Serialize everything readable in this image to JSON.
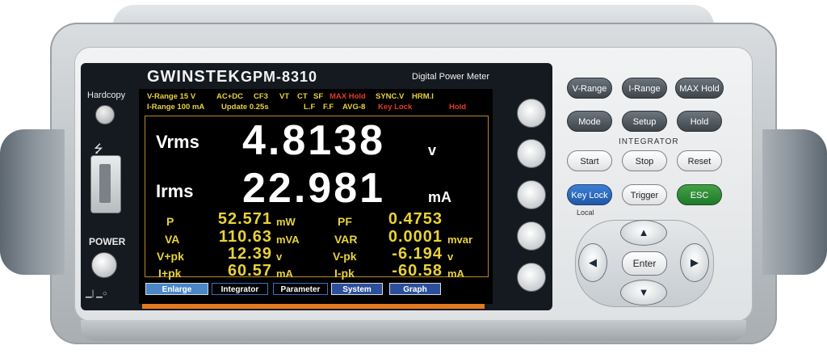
{
  "device": {
    "brand": "GWINSTEK",
    "model": "GPM-8310",
    "subtitle": "Digital Power Meter"
  },
  "left_panel": {
    "hardcopy_label": "Hardcopy",
    "usb_icon": "⭍",
    "power_label": "POWER",
    "power_icons": "▁| ▁○"
  },
  "status": {
    "row1": {
      "v_range": "V-Range 15 V",
      "coupling": "AC+DC",
      "crest": "CF3",
      "vt": "VT",
      "ct": "CT",
      "sf": "SF",
      "max_hold": "MAX Hold",
      "sync": "SYNC.V",
      "hrm": "HRM.I"
    },
    "row2": {
      "i_range": "I-Range 100 mA",
      "update": "Update 0.25s",
      "lf": "L.F",
      "ff": "F.F",
      "avg": "AVG-8",
      "key_lock": "Key Lock",
      "hold": "Hold"
    }
  },
  "main_readings": [
    {
      "label": "Vrms",
      "value": "4.8138",
      "unit": "v"
    },
    {
      "label": "Irms",
      "value": "22.981",
      "unit": "mA"
    }
  ],
  "secondary_readings": [
    {
      "label": "P",
      "value": "52.571",
      "unit": "mW",
      "label2": "PF",
      "value2": "0.4753",
      "unit2": ""
    },
    {
      "label": "VA",
      "value": "110.63",
      "unit": "mVA",
      "label2": "VAR",
      "value2": "0.0001",
      "unit2": "mvar"
    },
    {
      "label": "V+pk",
      "value": "12.39",
      "unit": "v",
      "label2": "V-pk",
      "value2": "-6.194",
      "unit2": "v"
    },
    {
      "label": "I+pk",
      "value": "60.57",
      "unit": "mA",
      "label2": "I-pk",
      "value2": "-60.58",
      "unit2": "mA"
    }
  ],
  "softkeys": [
    "Enlarge",
    "Integrator",
    "Parameter",
    "System",
    "Graph"
  ],
  "keypad": {
    "v_range": "V-Range",
    "i_range": "I-Range",
    "max_hold": "MAX Hold",
    "mode": "Mode",
    "setup": "Setup",
    "hold": "Hold",
    "integrator_title": "INTEGRATOR",
    "start": "Start",
    "stop": "Stop",
    "reset": "Reset",
    "key_lock": "Key Lock",
    "local": "Local",
    "trigger": "Trigger",
    "esc": "ESC",
    "enter": "Enter",
    "up": "▲",
    "down": "▼",
    "left": "◀",
    "right": "▶"
  },
  "colors": {
    "reading_yellow": "#e8d23a",
    "status_red": "#e23b2b",
    "status_green": "#57d13a",
    "softkey_blue": "#2c4f9b",
    "accent_orange": "#e37a1f"
  }
}
